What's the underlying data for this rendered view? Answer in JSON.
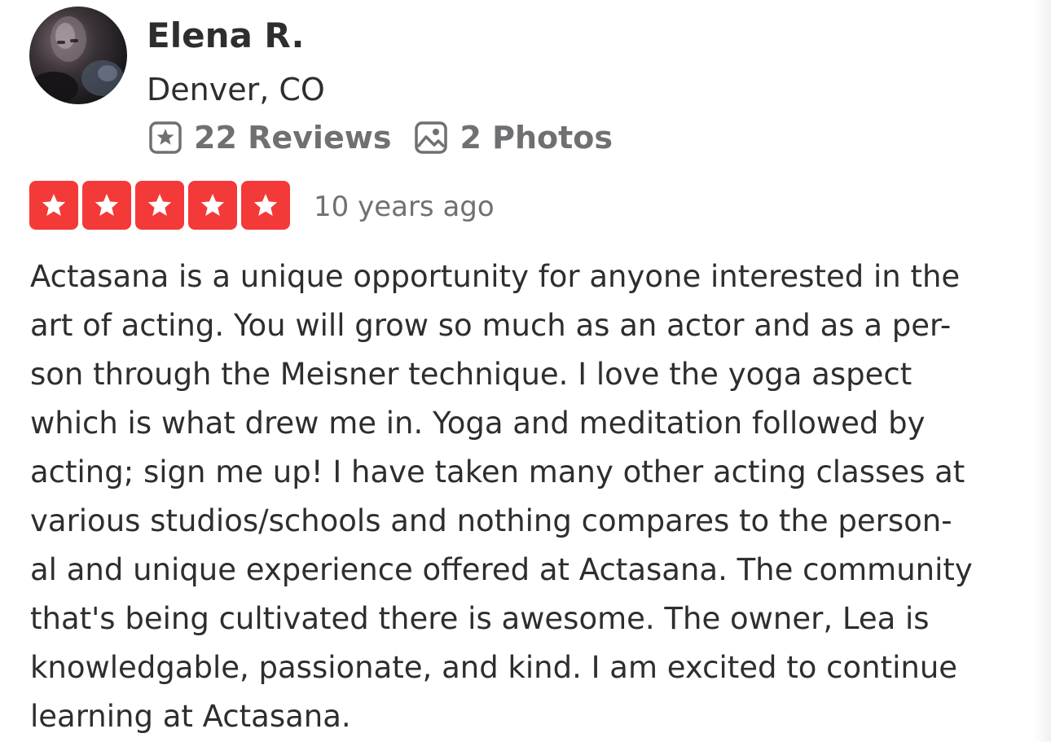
{
  "user": {
    "name": "Elena R.",
    "location": "Denver, CO",
    "avatar_icon": "user-avatar-photo",
    "stats": {
      "reviews_label": "22 Reviews",
      "reviews_icon": "star-square-icon",
      "photos_label": "2 Photos",
      "photos_icon": "photo-icon"
    }
  },
  "review": {
    "rating": 5,
    "rating_max": 5,
    "star_color": "#f43939",
    "date": "10 years ago",
    "lines": [
      "Actasana is a unique opportunity for anyone interested in the",
      "art of acting. You will grow so much as an actor and as a per-",
      "son through the Meisner technique. I love the yoga aspect",
      "which is what drew me in. Yoga and meditation followed by",
      "acting; sign me up! I have taken many other acting classes at",
      "various studios/schools and nothing compares to the person-",
      "al and unique experience offered at Actasana. The community",
      "that's being cultivated there is awesome. The owner, Lea is",
      "knowledgable, passionate, and kind. I am excited to continue",
      "learning at Actasana."
    ]
  },
  "colors": {
    "text_primary": "#2d2e2f",
    "text_secondary": "#6e7072",
    "rating_red": "#f43939"
  }
}
